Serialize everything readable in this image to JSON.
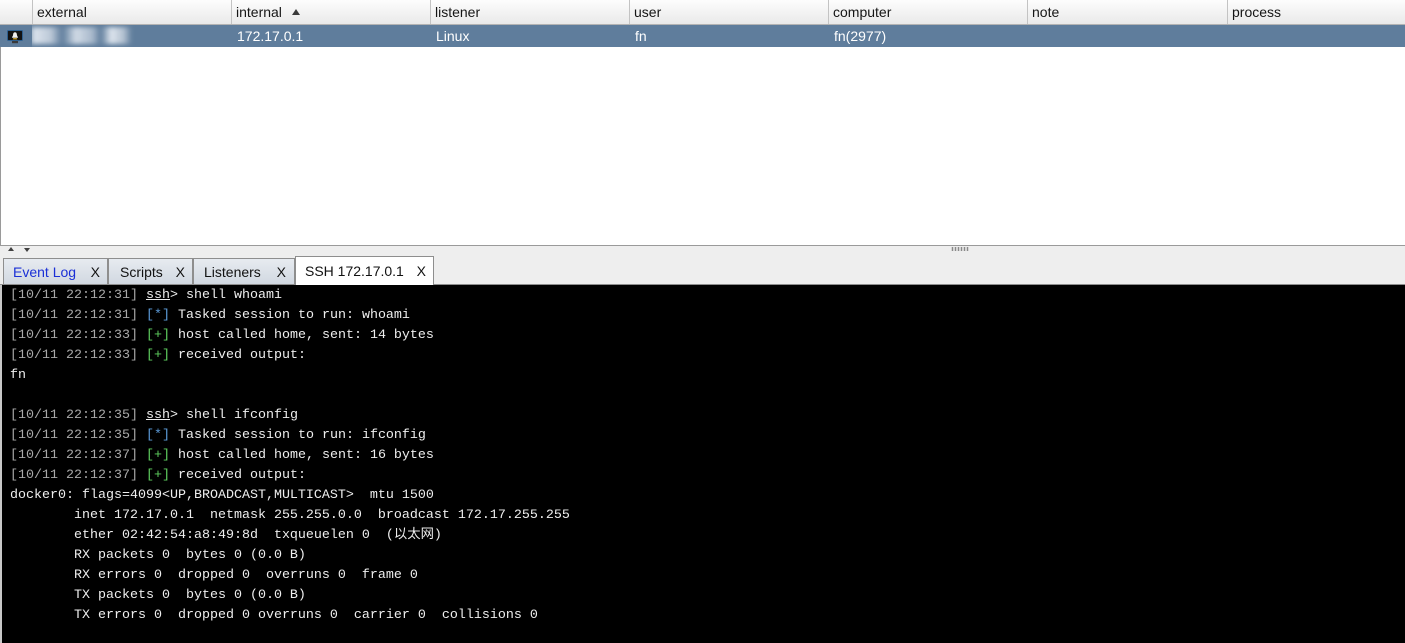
{
  "colors": {
    "selected_row": "#5f7d9c",
    "unread_tab_label": "#1a2fd6",
    "console_background": "#000000",
    "console_text": "#eeeeee",
    "timestamp": "#a9a9a9",
    "markers": {
      "[*]": "#5c9bd9",
      "[+]": "#5fcf5f"
    }
  },
  "sessions_table": {
    "columns": {
      "external": "external",
      "internal": "internal",
      "listener": "listener",
      "user": "user",
      "computer": "computer",
      "note": "note",
      "process": "process"
    },
    "internal_sort_icon": "sort-ascending-icon",
    "rows": [
      {
        "icon": "linux-session-monitor-icon",
        "internal": "172.17.0.1",
        "listener": "Linux",
        "user": "fn",
        "computer": "fn(2977)",
        "selected": true
      }
    ]
  },
  "tabs": [
    {
      "label": "Event Log",
      "close": "X",
      "unread": true
    },
    {
      "label": "Scripts",
      "close": "X"
    },
    {
      "label": "Listeners",
      "close": "X"
    },
    {
      "label": "SSH 172.17.0.1",
      "close": "X",
      "active": true
    }
  ],
  "console": {
    "lines": [
      {
        "ts": "[10/11 22:12:31]",
        "prompt": "ssh",
        "command": "> shell whoami"
      },
      {
        "ts": "[10/11 22:12:31]",
        "marker": "[*]",
        "text": "Tasked session to run: whoami"
      },
      {
        "ts": "[10/11 22:12:33]",
        "marker": "[+]",
        "text": "host called home, sent: 14 bytes"
      },
      {
        "ts": "[10/11 22:12:33]",
        "marker": "[+]",
        "text": "received output:"
      },
      {
        "text": "fn"
      },
      {
        "text": ""
      },
      {
        "ts": "[10/11 22:12:35]",
        "prompt": "ssh",
        "command": "> shell ifconfig"
      },
      {
        "ts": "[10/11 22:12:35]",
        "marker": "[*]",
        "text": "Tasked session to run: ifconfig"
      },
      {
        "ts": "[10/11 22:12:37]",
        "marker": "[+]",
        "text": "host called home, sent: 16 bytes"
      },
      {
        "ts": "[10/11 22:12:37]",
        "marker": "[+]",
        "text": "received output:"
      },
      {
        "text": "docker0: flags=4099<UP,BROADCAST,MULTICAST>  mtu 1500"
      },
      {
        "text": "        inet 172.17.0.1  netmask 255.255.0.0  broadcast 172.17.255.255"
      },
      {
        "text": "        ether 02:42:54:a8:49:8d  txqueuelen 0  (以太网)"
      },
      {
        "text": "        RX packets 0  bytes 0 (0.0 B)"
      },
      {
        "text": "        RX errors 0  dropped 0  overruns 0  frame 0"
      },
      {
        "text": "        TX packets 0  bytes 0 (0.0 B)"
      },
      {
        "text": "        TX errors 0  dropped 0 overruns 0  carrier 0  collisions 0"
      }
    ]
  }
}
